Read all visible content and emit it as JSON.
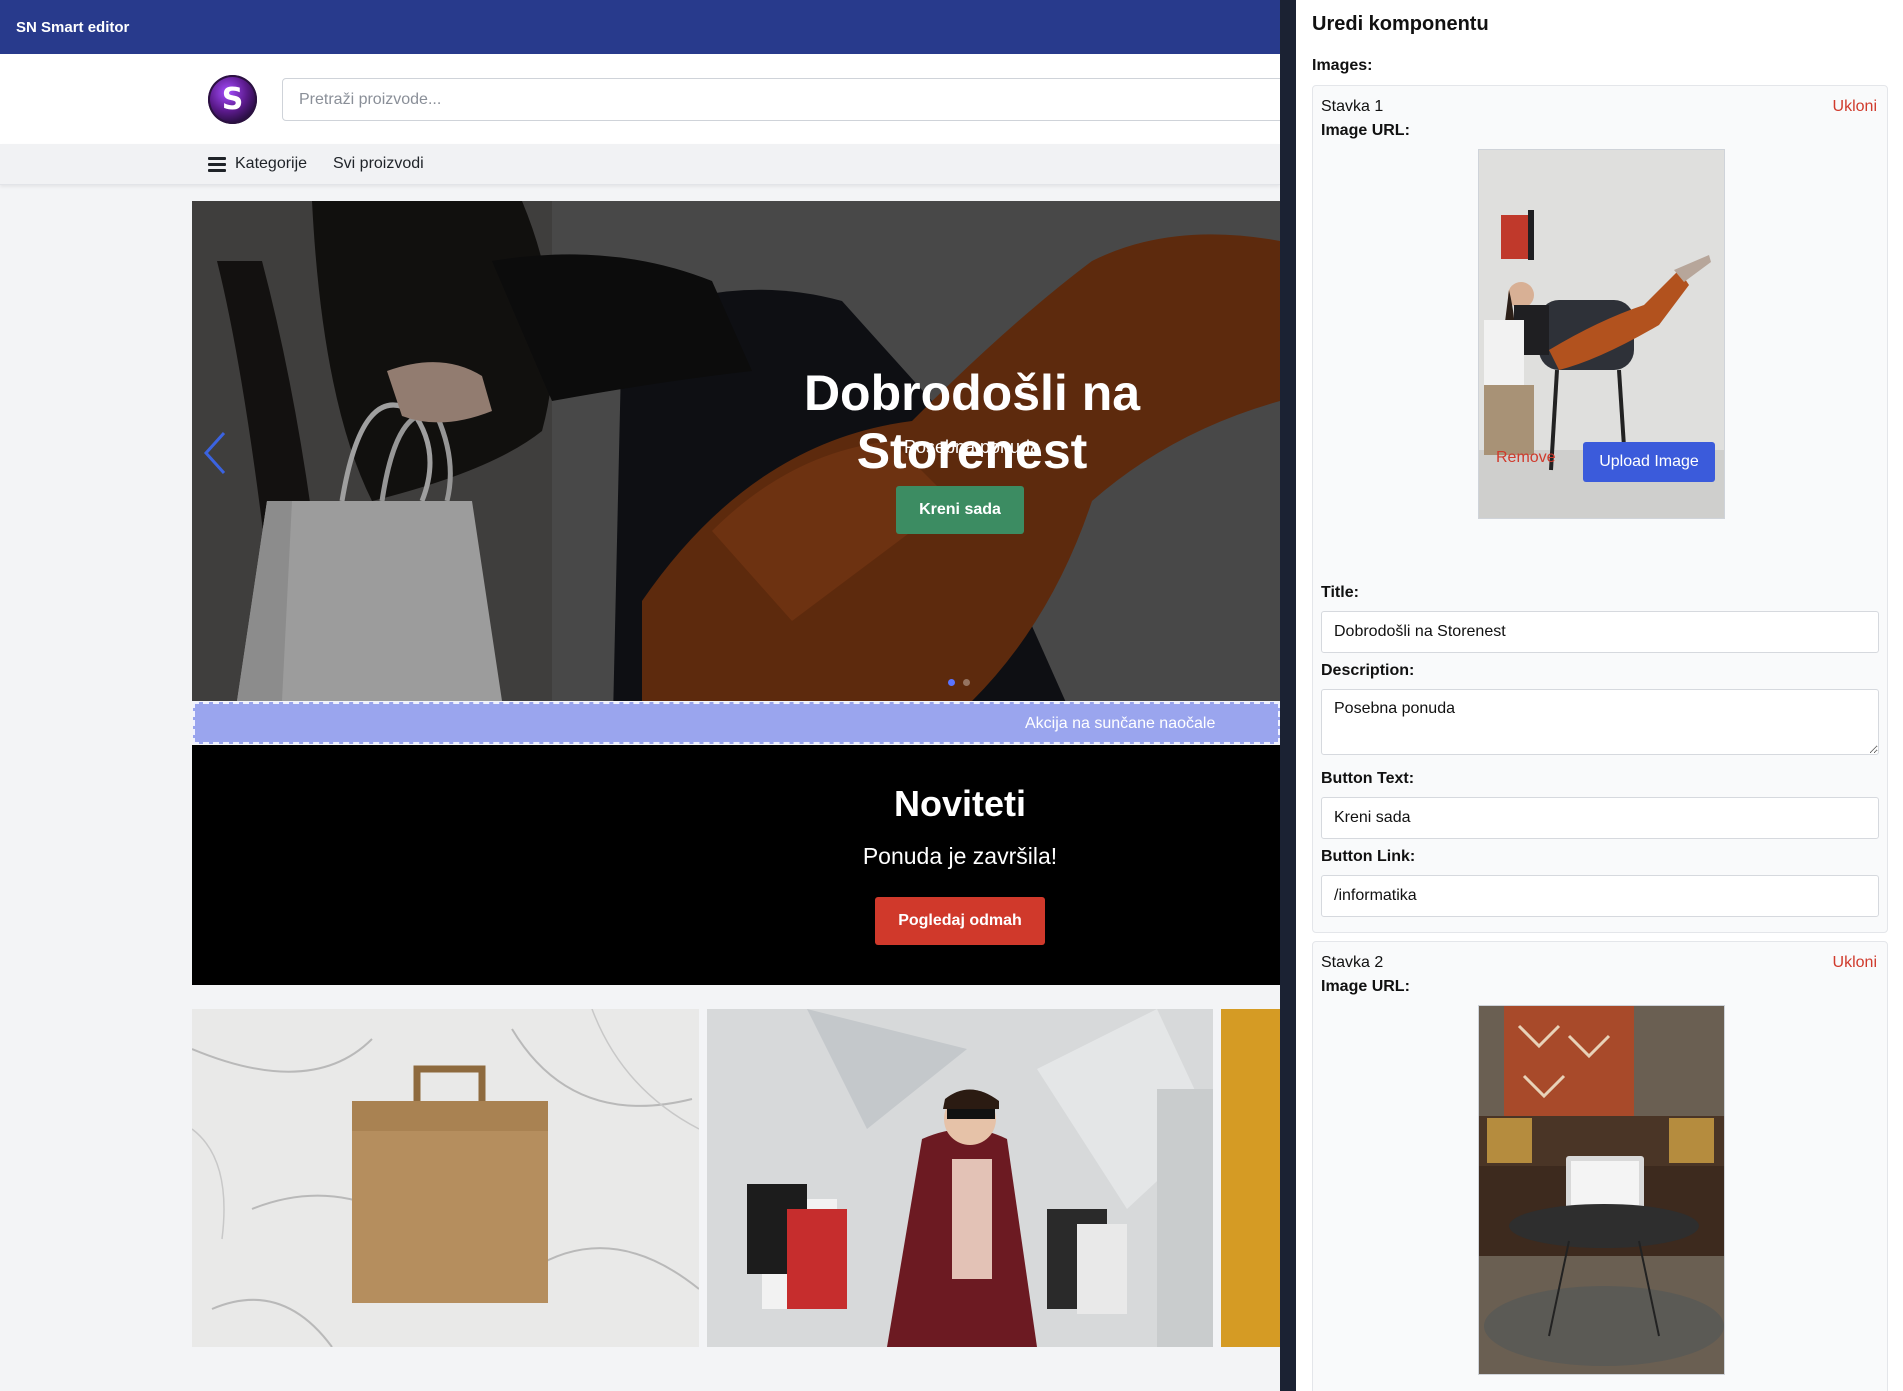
{
  "app": {
    "title": "SN Smart editor"
  },
  "header": {
    "logo_letter": "S",
    "search_placeholder": "Pretraži proizvode..."
  },
  "nav": {
    "categories": "Kategorije",
    "all_products": "Svi proizvodi"
  },
  "hero": {
    "title": "Dobrodošli na Storenest",
    "description": "Posebna ponuda",
    "button": "Kreni sada",
    "button_color": "#3c8c62",
    "active_slide": 1,
    "slide_count": 2
  },
  "announcement": {
    "text": "Akcija na sunčane naočale",
    "color": "#9aa5ee"
  },
  "promo": {
    "title": "Noviteti",
    "subtitle": "Ponuda je završila!",
    "button": "Pogledaj odmah",
    "button_color": "#d0392b"
  },
  "panel": {
    "title": "Uredi komponentu",
    "images_label": "Images:",
    "items": [
      {
        "heading": "Stavka 1",
        "remove": "Ukloni",
        "image_url_label": "Image URL:",
        "image_remove": "Remove",
        "upload": "Upload Image",
        "title_label": "Title:",
        "title_value": "Dobrodošli na Storenest",
        "description_label": "Description:",
        "description_value": "Posebna ponuda",
        "button_text_label": "Button Text:",
        "button_text_value": "Kreni sada",
        "button_link_label": "Button Link:",
        "button_link_value": "/informatika"
      },
      {
        "heading": "Stavka 2",
        "remove": "Ukloni",
        "image_url_label": "Image URL:"
      }
    ]
  },
  "colors": {
    "topbar": "#283a8c",
    "upload_button": "#3b5bdb",
    "danger_text": "#d03a2c"
  }
}
